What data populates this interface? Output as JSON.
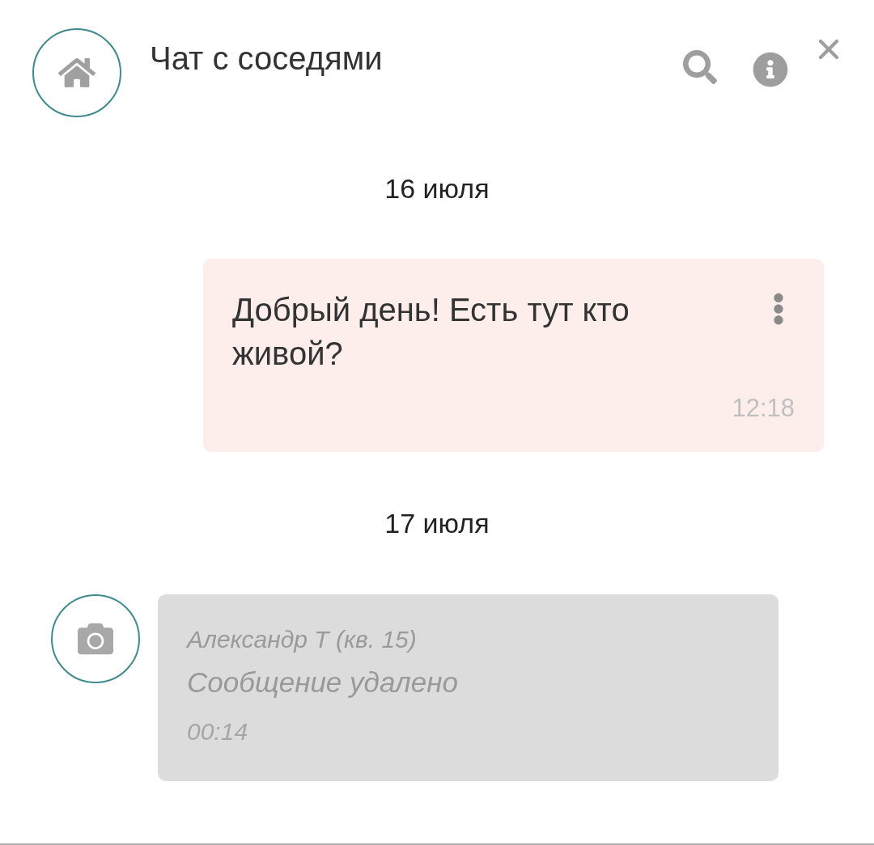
{
  "header": {
    "title": "Чат с соседями"
  },
  "messages": [
    {
      "kind": "date",
      "text": "16 июля"
    },
    {
      "kind": "outgoing",
      "text": "Добрый день! Есть тут кто живой?",
      "time": "12:18"
    },
    {
      "kind": "date",
      "text": "17 июля"
    },
    {
      "kind": "deleted",
      "author": "Александр Т (кв. 15)",
      "text": "Сообщение удалено",
      "time": "00:14"
    }
  ]
}
